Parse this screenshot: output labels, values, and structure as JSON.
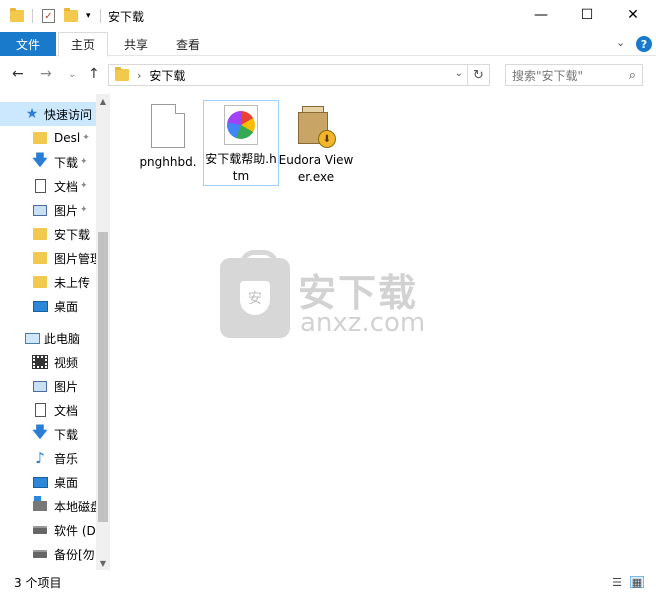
{
  "window": {
    "title": "安下载",
    "controls": {
      "minimize": "—",
      "maximize": "☐",
      "close": "✕"
    }
  },
  "ribbon": {
    "file_tab": "文件",
    "tabs": [
      "主页",
      "共享",
      "查看"
    ],
    "expand_glyph": "⌄",
    "help_glyph": "?"
  },
  "address": {
    "back": "←",
    "forward": "→",
    "recent": "⌄",
    "up": "↑",
    "crumbs": [
      "安下载"
    ],
    "dropdown": "⌄",
    "refresh": "↻",
    "search_placeholder": "搜索\"安下载\"",
    "search_glyph": "⌕"
  },
  "sidebar": {
    "items": [
      {
        "label": "快速访问",
        "icon": "star-icon",
        "pinned": false
      },
      {
        "label": "Desl",
        "icon": "folder-icon",
        "pinned": true
      },
      {
        "label": "下载",
        "icon": "download-icon",
        "pinned": true
      },
      {
        "label": "文档",
        "icon": "document-icon",
        "pinned": true
      },
      {
        "label": "图片",
        "icon": "picture-icon",
        "pinned": true
      },
      {
        "label": "安下载",
        "icon": "folder-icon",
        "pinned": false
      },
      {
        "label": "图片管理",
        "icon": "folder-icon",
        "pinned": false
      },
      {
        "label": "未上传",
        "icon": "folder-icon",
        "pinned": false
      },
      {
        "label": "桌面",
        "icon": "desktop-icon",
        "pinned": false
      },
      {
        "label": "此电脑",
        "icon": "computer-icon",
        "pinned": false
      },
      {
        "label": "视频",
        "icon": "video-icon",
        "pinned": false
      },
      {
        "label": "图片",
        "icon": "picture-icon",
        "pinned": false
      },
      {
        "label": "文档",
        "icon": "document-icon",
        "pinned": false
      },
      {
        "label": "下载",
        "icon": "download-icon",
        "pinned": false
      },
      {
        "label": "音乐",
        "icon": "music-icon",
        "pinned": false
      },
      {
        "label": "桌面",
        "icon": "desktop-icon",
        "pinned": false
      },
      {
        "label": "本地磁盘",
        "icon": "drive-icon",
        "pinned": false
      },
      {
        "label": "软件 (D",
        "icon": "drive-icon",
        "pinned": false
      },
      {
        "label": "备份[勿",
        "icon": "drive-icon",
        "pinned": false
      }
    ],
    "pin_glyph": "📌"
  },
  "files": [
    {
      "name": "pnghhbd.",
      "icon": "blank-file-icon"
    },
    {
      "name": "安下载帮助.htm",
      "icon": "chrome-html-icon"
    },
    {
      "name": "Eudora Viewer.exe",
      "icon": "installer-icon"
    }
  ],
  "watermark": {
    "cn": "安下载",
    "en": "anxz.com",
    "shield": "安"
  },
  "status": {
    "item_count": "3 个项目"
  }
}
